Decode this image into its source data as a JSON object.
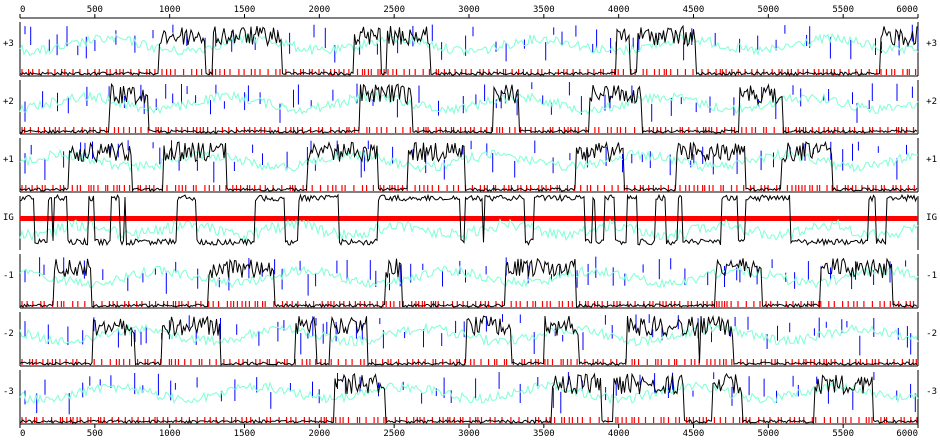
{
  "chart_data": {
    "type": "line",
    "x_range": [
      0,
      6000
    ],
    "x_ticks": [
      0,
      500,
      1000,
      1500,
      2000,
      2500,
      3000,
      3500,
      4000,
      4500,
      5000,
      5500,
      6000
    ],
    "x_tick_labels": [
      "0",
      "500",
      "1000",
      "1500",
      "2000",
      "2500",
      "3000",
      "3500",
      "4000",
      "4500",
      "5000",
      "5500",
      "6000"
    ],
    "frames": [
      {
        "label": "+3",
        "type": "coding"
      },
      {
        "label": "+2",
        "type": "coding"
      },
      {
        "label": "+1",
        "type": "coding"
      },
      {
        "label": "IG",
        "type": "intergenic"
      },
      {
        "label": "-1",
        "type": "coding"
      },
      {
        "label": "-2",
        "type": "coding"
      },
      {
        "label": "-3",
        "type": "coding"
      }
    ],
    "colors": {
      "coding_potential": "#000000",
      "gc_trace": "#7fffd4",
      "start_codons": "#0000ff",
      "stop_codons": "#ff0000",
      "intergenic_band": "#ff0000",
      "axis": "#000000"
    }
  }
}
